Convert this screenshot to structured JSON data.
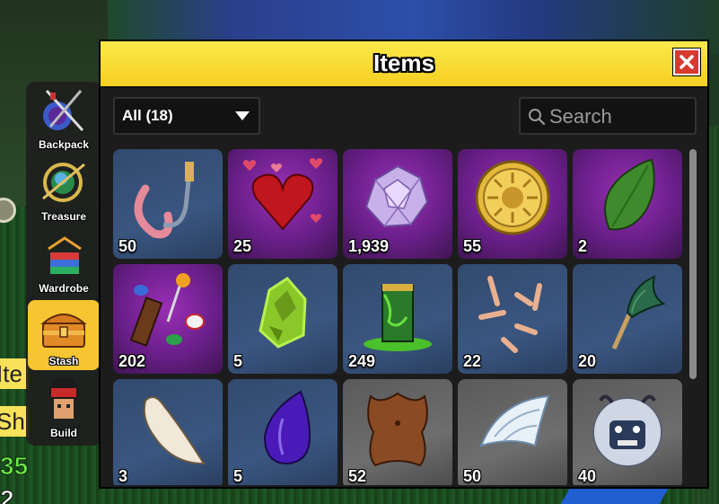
{
  "window": {
    "title": "Items",
    "filter": {
      "selected": "All (18)"
    },
    "search": {
      "placeholder": "Search",
      "value": ""
    },
    "items": [
      {
        "name": "hook",
        "quantity": "50",
        "rarity_bg": "blue"
      },
      {
        "name": "hearts",
        "quantity": "25",
        "rarity_bg": "purple"
      },
      {
        "name": "crystal-shards",
        "quantity": "1,939",
        "rarity_bg": "purple"
      },
      {
        "name": "sun-coin",
        "quantity": "55",
        "rarity_bg": "purple"
      },
      {
        "name": "green-leaf",
        "quantity": "2",
        "rarity_bg": "purple"
      },
      {
        "name": "candy",
        "quantity": "202",
        "rarity_bg": "purple"
      },
      {
        "name": "green-rock",
        "quantity": "5",
        "rarity_bg": "blue"
      },
      {
        "name": "slime-cup",
        "quantity": "249",
        "rarity_bg": "blue"
      },
      {
        "name": "bones",
        "quantity": "22",
        "rarity_bg": "blue"
      },
      {
        "name": "fish-tail",
        "quantity": "20",
        "rarity_bg": "blue"
      },
      {
        "name": "fang",
        "quantity": "3",
        "rarity_bg": "blue"
      },
      {
        "name": "purple-drop",
        "quantity": "5",
        "rarity_bg": "blue"
      },
      {
        "name": "leather",
        "quantity": "52",
        "rarity_bg": "gray"
      },
      {
        "name": "wing",
        "quantity": "50",
        "rarity_bg": "gray"
      },
      {
        "name": "yeti-head",
        "quantity": "40",
        "rarity_bg": "gray"
      }
    ]
  },
  "sidebar": {
    "items": [
      {
        "label": "Backpack",
        "icon": "backpack-icon",
        "active": false
      },
      {
        "label": "Treasure",
        "icon": "treasure-icon",
        "active": false
      },
      {
        "label": "Wardrobe",
        "icon": "wardrobe-icon",
        "active": false
      },
      {
        "label": "Stash",
        "icon": "stash-icon",
        "active": true
      },
      {
        "label": "Build",
        "icon": "build-icon",
        "active": false
      }
    ]
  },
  "hud": {
    "item_a": "Ite",
    "item_b": "Sh",
    "green_number": "35",
    "white_number": "2"
  },
  "colors": {
    "title_bar": "#f7d52c",
    "close_button": "#d7392e",
    "active_tab": "#f7c531",
    "purple_rarity": "#7a24a0",
    "blue_rarity": "#35507a",
    "gray_rarity": "#606060"
  }
}
